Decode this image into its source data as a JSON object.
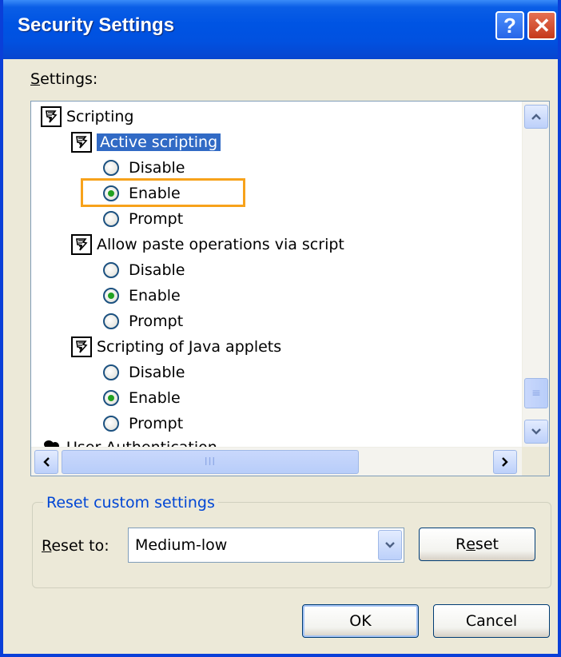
{
  "window": {
    "title": "Security Settings",
    "help_glyph": "?",
    "close_glyph": "✕"
  },
  "settings_label": {
    "mnemonic": "S",
    "rest": "ettings:"
  },
  "tree": {
    "category": "Scripting",
    "groups": [
      {
        "label": "Active scripting",
        "selected": true,
        "options": [
          {
            "label": "Disable",
            "checked": false
          },
          {
            "label": "Enable",
            "checked": true
          },
          {
            "label": "Prompt",
            "checked": false
          }
        ]
      },
      {
        "label": "Allow paste operations via script",
        "selected": false,
        "options": [
          {
            "label": "Disable",
            "checked": false
          },
          {
            "label": "Enable",
            "checked": true
          },
          {
            "label": "Prompt",
            "checked": false
          }
        ]
      },
      {
        "label": "Scripting of Java applets",
        "selected": false,
        "options": [
          {
            "label": "Disable",
            "checked": false
          },
          {
            "label": "Enable",
            "checked": true
          },
          {
            "label": "Prompt",
            "checked": false
          }
        ]
      }
    ],
    "next_category_partial": "User Authentication"
  },
  "reset_group": {
    "legend": "Reset custom settings",
    "reset_to_mnemonic": "R",
    "reset_to_rest": "eset to:",
    "selected_level": "Medium-low",
    "reset_button_pre": "R",
    "reset_button_mnemonic": "e",
    "reset_button_post": "set"
  },
  "buttons": {
    "ok": "OK",
    "cancel": "Cancel"
  },
  "scrollbar_grip": "≡",
  "hscroll_grip": "III",
  "colors": {
    "title_blue": "#0054e3",
    "selection": "#316ac5",
    "focus_highlight": "#f7a21b",
    "radio_dot": "#21a121"
  }
}
